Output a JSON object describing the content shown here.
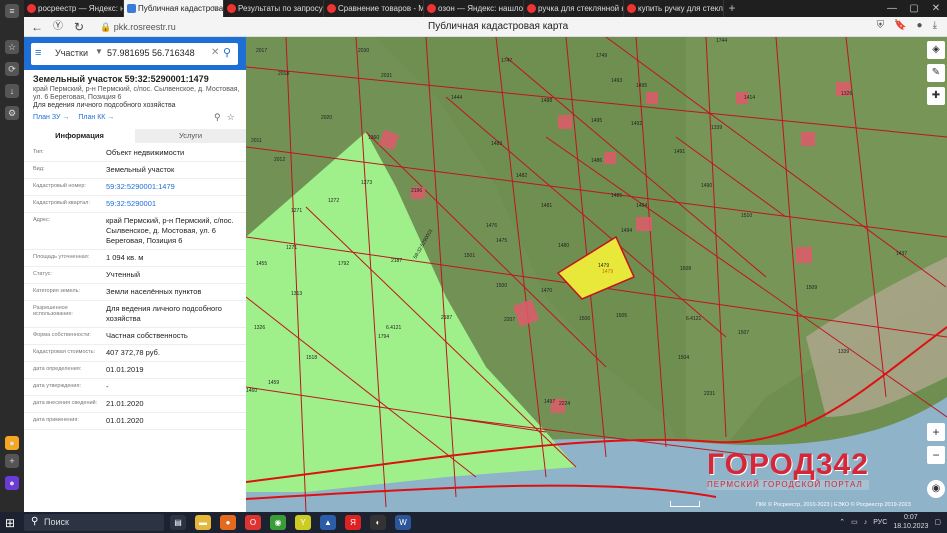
{
  "browser": {
    "tabs": [
      {
        "label": "росреестр — Яндекс: нашл",
        "active": false
      },
      {
        "label": "Публичная кадастровая",
        "active": true
      },
      {
        "label": "Результаты по запросу «р",
        "active": false
      },
      {
        "label": "Сравнение товаров - Мар",
        "active": false
      },
      {
        "label": "озон — Яндекс: нашлось",
        "active": false
      },
      {
        "label": "ручка для стеклянной кр",
        "active": false
      },
      {
        "label": "купить ручку для стеклян",
        "active": false
      }
    ],
    "url": "pkk.rosreestr.ru",
    "page_title": "Публичная кадастровая карта"
  },
  "search": {
    "type": "Участки",
    "value": "57.981695 56.716348"
  },
  "object": {
    "title": "Земельный участок 59:32:5290001:1479",
    "address": "край Пермский, р-н Пермский, с/пос. Сылвенское, д. Мостовая, ул. 6 Береговая, Позиция 6",
    "purpose": "Для ведения личного подсобного хозяйства",
    "plan_zu": "План ЗУ →",
    "plan_kk": "План КК →"
  },
  "info_tabs": {
    "info": "Информация",
    "services": "Услуги"
  },
  "rows": [
    {
      "label": "Тип:",
      "value": "Объект недвижимости",
      "link": false
    },
    {
      "label": "Вид:",
      "value": "Земельный участок",
      "link": false
    },
    {
      "label": "Кадастровый номер:",
      "value": "59:32:5290001:1479",
      "link": true
    },
    {
      "label": "Кадастровый квартал:",
      "value": "59:32:5290001",
      "link": true
    },
    {
      "label": "Адрес:",
      "value": "край Пермский, р-н Пермский, с/пос. Сылвенское, д. Мостовая, ул. 6 Береговая, Позиция 6",
      "link": false
    },
    {
      "label": "Площадь уточненная:",
      "value": "1 094 кв. м",
      "link": false
    },
    {
      "label": "Статус:",
      "value": "Учтенный",
      "link": false
    },
    {
      "label": "Категория земель:",
      "value": "Земли населённых пунктов",
      "link": false
    },
    {
      "label": "Разрешенное использование:",
      "value": "Для ведения личного подсобного хозяйства",
      "link": false
    },
    {
      "label": "Форма собственности:",
      "value": "Частная собственность",
      "link": false
    },
    {
      "label": "Кадастровая стоимость:",
      "value": "407 372,78 руб.",
      "link": false
    },
    {
      "label": "дата определения:",
      "value": "01.01.2019",
      "link": false
    },
    {
      "label": "дата утверждения:",
      "value": "-",
      "link": false
    },
    {
      "label": "дата внесения сведений:",
      "value": "21.01.2020",
      "link": false
    },
    {
      "label": "дата применения:",
      "value": "01.01.2020",
      "link": false
    }
  ],
  "map": {
    "parcel_labels": [
      "2017",
      "2030",
      "1747",
      "1749",
      "1493",
      "1495",
      "1744",
      "1492",
      "1414",
      "1326",
      "2018",
      "2031",
      "1444",
      "1488",
      "1491",
      "1339",
      "1483",
      "1486",
      "2020",
      "1360",
      "2011",
      "1495",
      "1482",
      "1490",
      "2012",
      "2196",
      "1485",
      "1273",
      "1481",
      "1484",
      "1510",
      "1271",
      "1272",
      "2187",
      "1476",
      "1475",
      "1480",
      "1494",
      "1271",
      "1792",
      "1501",
      "1470",
      "1455",
      "1479",
      "1508",
      "1437",
      "1509",
      "1313",
      "1500",
      "2207",
      "1505",
      "1507",
      "1326",
      "6.4121",
      "2187",
      "1794",
      "1506",
      "1504",
      "1518",
      "1339",
      "1459",
      "2231",
      "1460",
      "1497",
      "2224",
      "6.4121"
    ],
    "selected_label": "1479",
    "quarter_label": "59:32:5290001"
  },
  "watermark": {
    "brand": "ГОРОД342",
    "sub": "ПЕРМСКИЙ ГОРОДСКОЙ ПОРТАЛ"
  },
  "copyright": "ПКК © Росреестр, 2010-2023 | ЕЭКО © Росреестр 2019-2023",
  "taskbar": {
    "search_placeholder": "Поиск",
    "lang": "РУС",
    "time": "0:07",
    "date": "18.10.2023"
  },
  "colors": {
    "accent": "#1d6fd6",
    "parcel_line": "#c0141e",
    "selected_fill": "#e8e83a",
    "green_zone": "#9ff08a"
  }
}
